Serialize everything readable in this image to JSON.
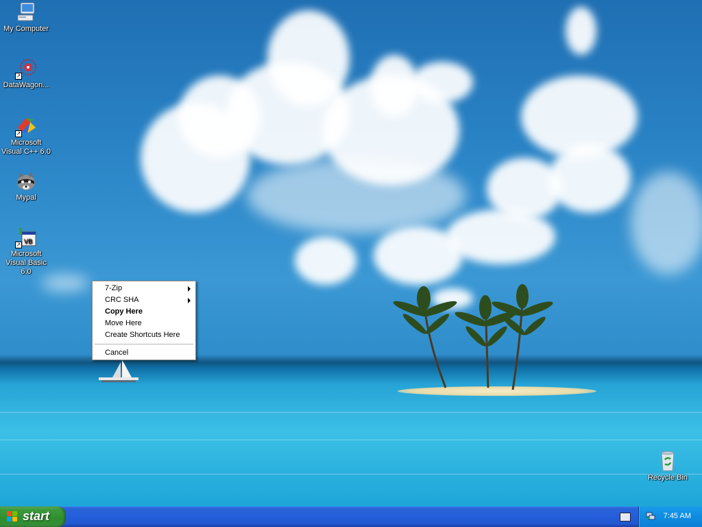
{
  "desktop": {
    "icons": [
      {
        "label": "My Computer"
      },
      {
        "label": "DataWagon..."
      },
      {
        "label": "Microsoft Visual C++ 6.0"
      },
      {
        "label": "Mypal"
      },
      {
        "label": "Microsoft Visual Basic 6.0"
      },
      {
        "label": "Recycle Bin"
      }
    ]
  },
  "context_menu": {
    "items": [
      {
        "label": "7-Zip",
        "has_submenu": true
      },
      {
        "label": "CRC SHA",
        "has_submenu": true
      },
      {
        "label": "Copy Here",
        "default": true
      },
      {
        "label": "Move Here"
      },
      {
        "label": "Create Shortcuts Here"
      },
      {
        "label": "Cancel"
      }
    ]
  },
  "taskbar": {
    "start_label": "start",
    "clock": "7:45 AM"
  },
  "colors": {
    "taskbar_blue": "#245edb",
    "start_green": "#3c9a3c",
    "tray_blue": "#0f8ce0"
  }
}
